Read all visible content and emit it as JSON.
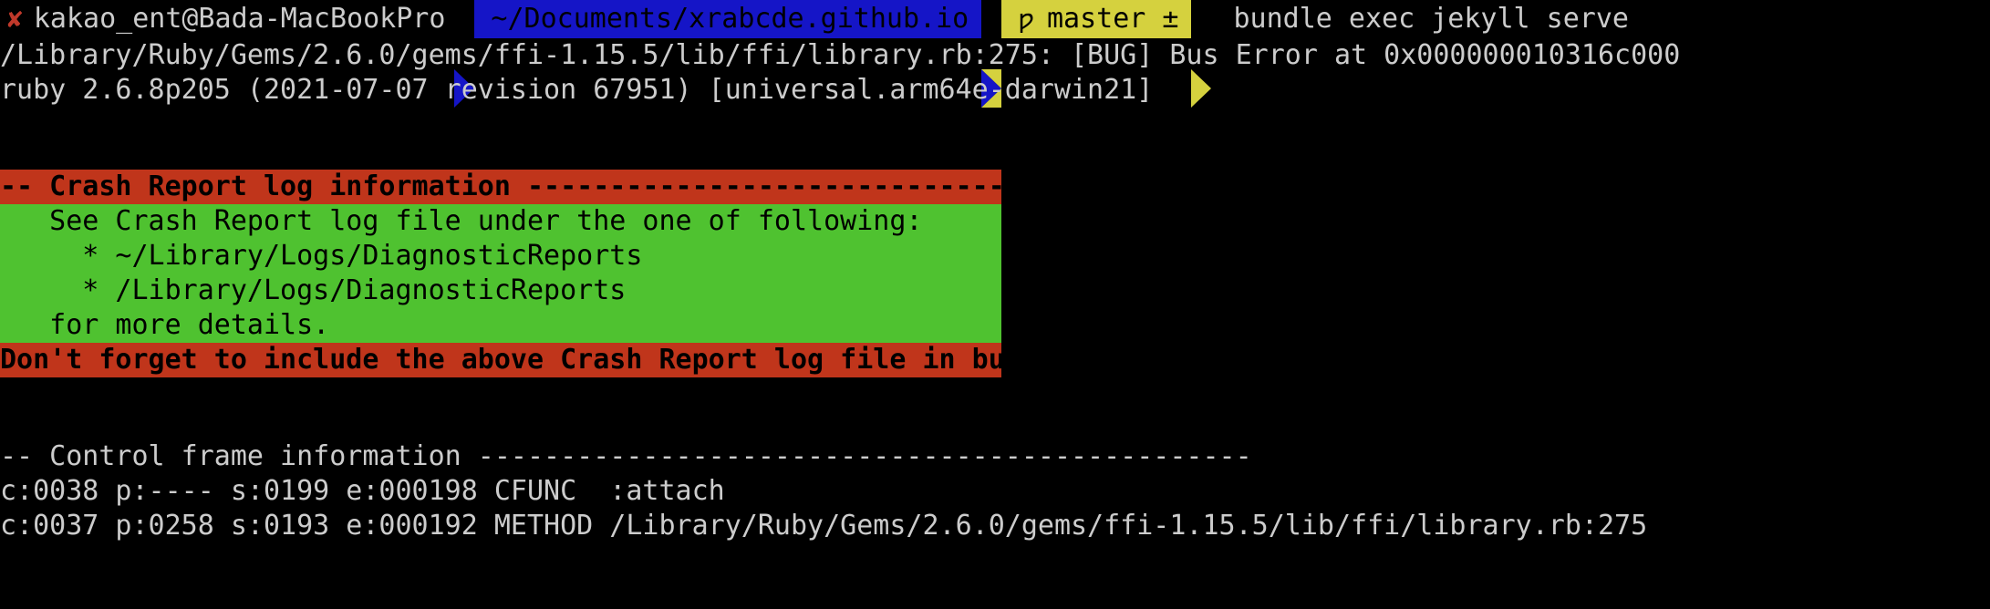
{
  "terminal": {
    "prompt": {
      "status_icon": "cross-mark-icon",
      "status_glyph": "✘",
      "user_host": "kakao_ent@Bada-MacBookPro",
      "path": "~/Documents/xrabcde.github.io",
      "git_glyph": "ƿ",
      "git_branch": "master ±",
      "command": "bundle exec jekyll serve",
      "colors": {
        "path_bg": "#1515c7",
        "git_bg": "#d5d13e",
        "status": "#c0392b",
        "text": "#cccccc"
      }
    },
    "output": {
      "bug_line": "/Library/Ruby/Gems/2.6.0/gems/ffi-1.15.5/lib/ffi/library.rb:275: [BUG] Bus Error at 0x000000010316c000",
      "ruby_version_line": "ruby 2.6.8p205 (2021-07-07 revision 67951) [universal.arm64e-darwin21]",
      "crash_report": {
        "header": "-- Crash Report log information --------------------------------------------",
        "body": [
          "   See Crash Report log file under the one of following:",
          "     * ~/Library/Logs/DiagnosticReports",
          "     * /Library/Logs/DiagnosticReports",
          "   for more details.",
          ""
        ],
        "footer": "Don't forget to include the above Crash Report log file in bug reports.",
        "colors": {
          "header_bg": "#c0351b",
          "body_bg": "#4fc230",
          "footer_bg": "#c0351b",
          "banner_text": "#000000"
        }
      },
      "control_frame": {
        "header": "-- Control frame information -----------------------------------------------",
        "frames": [
          "c:0038 p:---- s:0199 e:000198 CFUNC  :attach",
          "c:0037 p:0258 s:0193 e:000192 METHOD /Library/Ruby/Gems/2.6.0/gems/ffi-1.15.5/lib/ffi/library.rb:275"
        ]
      }
    }
  }
}
